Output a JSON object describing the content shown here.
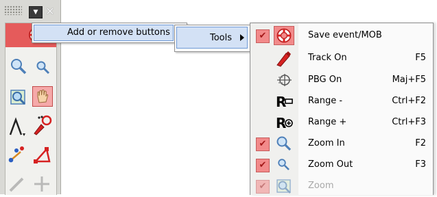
{
  "menu_path": {
    "add_remove_label": "Add or remove buttons",
    "tools_label": "Tools"
  },
  "tools_menu": {
    "items": [
      {
        "label": "Save event/MOB",
        "shortcut": "",
        "checked": true,
        "enabled": true,
        "icon": "lifebuoy-icon"
      },
      {
        "label": "Track On",
        "shortcut": "F5",
        "checked": false,
        "enabled": true,
        "icon": "track-pen-icon"
      },
      {
        "label": "PBG On",
        "shortcut": "Maj+F5",
        "checked": false,
        "enabled": true,
        "icon": "pbg-target-icon"
      },
      {
        "label": "Range -",
        "shortcut": "Ctrl+F2",
        "checked": false,
        "enabled": true,
        "icon": "range-minus-icon"
      },
      {
        "label": "Range +",
        "shortcut": "Ctrl+F3",
        "checked": false,
        "enabled": true,
        "icon": "range-plus-icon"
      },
      {
        "label": "Zoom In",
        "shortcut": "F2",
        "checked": true,
        "enabled": true,
        "icon": "zoom-in-icon"
      },
      {
        "label": "Zoom Out",
        "shortcut": "F3",
        "checked": true,
        "enabled": true,
        "icon": "zoom-out-icon"
      },
      {
        "label": "Zoom",
        "shortcut": "",
        "checked": true,
        "enabled": false,
        "icon": "zoom-window-icon"
      }
    ]
  },
  "icon_glyphs": {
    "range_minus": "R=",
    "range_plus": "R+",
    "check": "✔",
    "close": "✕",
    "dropdown": "▼"
  },
  "colors": {
    "highlight_bg": "#d3e1f5",
    "highlight_border": "#6f9ad6",
    "check_bg": "#f28a8a",
    "toolbar_red": "#e55b5b"
  }
}
